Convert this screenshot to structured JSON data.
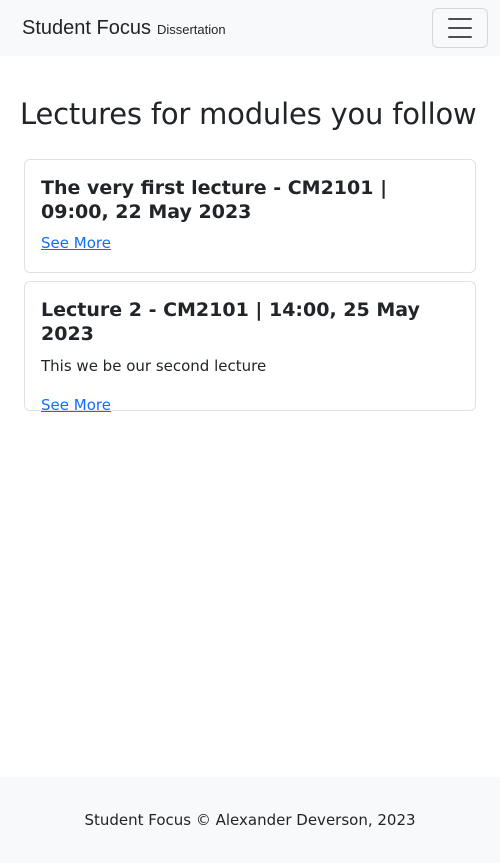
{
  "navbar": {
    "brand_title": "Student Focus",
    "brand_subtitle": "Dissertation",
    "toggler_icon": "hamburger-menu-icon"
  },
  "main": {
    "heading": "Lectures for modules you follow",
    "lectures": [
      {
        "title": "The very first lecture - CM2101 | 09:00, 22 May 2023",
        "description": "",
        "link_label": "See More"
      },
      {
        "title": "Lecture 2 - CM2101 | 14:00, 25 May 2023",
        "description": "This we be our second lecture",
        "link_label": "See More"
      }
    ]
  },
  "footer": {
    "text": "Student Focus © Alexander Deverson, 2023"
  },
  "colors": {
    "navbar_bg": "#f8f9fa",
    "link": "#0d6efd",
    "text": "#212529",
    "card_border": "#dee2e6"
  }
}
